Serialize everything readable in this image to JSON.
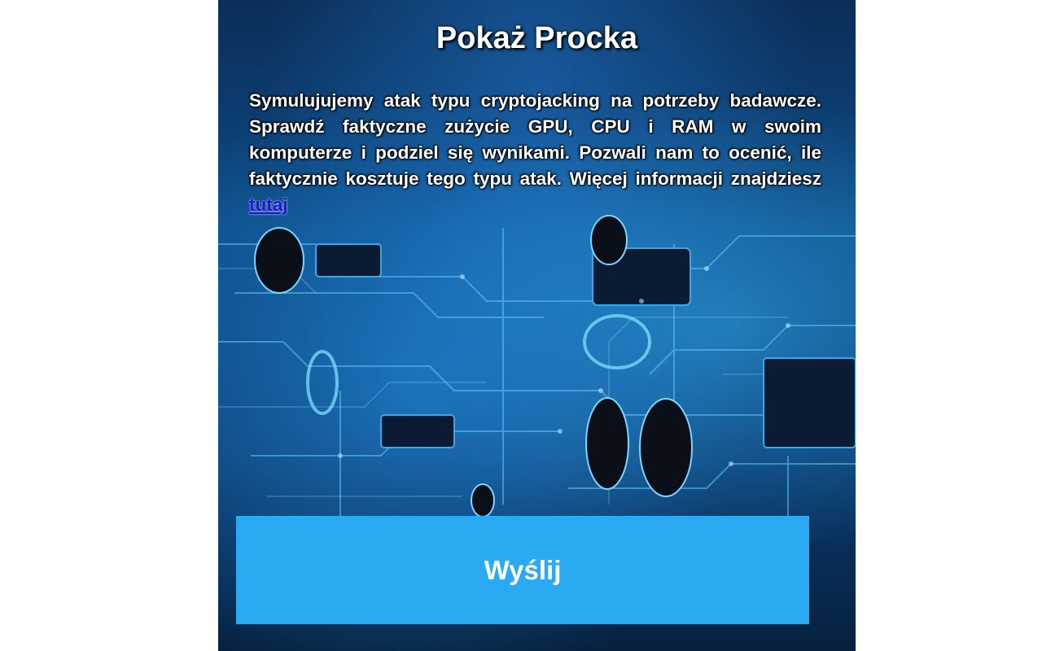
{
  "title": "Pokaż Procka",
  "description": {
    "text": "Symulujujemy atak typu cryptojacking na potrzeby badawcze. Sprawdź faktyczne zużycie GPU, CPU i RAM w swoim komputerze i podziel się wynikami. Pozwali nam to ocenić, ile faktycznie kosztuje tego typu atak. Więcej informacji znajdziesz ",
    "link_label": "tutaj"
  },
  "submit_label": "Wyślij",
  "colors": {
    "button": "#2aaaf2",
    "link": "#1a10e8",
    "background": "#0d4b86"
  },
  "background_image": "circuit-board"
}
